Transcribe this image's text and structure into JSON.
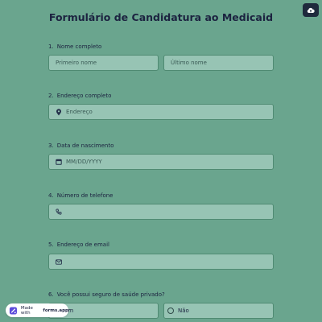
{
  "form": {
    "title": "Formulário de Candidatura ao Medicaid"
  },
  "questions": [
    {
      "number": "1.",
      "label": "Nome completo",
      "fields": [
        "Primeiro nome",
        "Último nome"
      ]
    },
    {
      "number": "2.",
      "label": "Endereço completo",
      "placeholder": "Endereço",
      "icon": "location-pin-icon"
    },
    {
      "number": "3.",
      "label": "Data de nascimento",
      "placeholder": "MM/DD/YYYY",
      "icon": "calendar-icon"
    },
    {
      "number": "4.",
      "label": "Número de telefone",
      "placeholder": "",
      "icon": "phone-icon"
    },
    {
      "number": "5.",
      "label": "Endereço de email",
      "placeholder": "",
      "icon": "mail-icon"
    },
    {
      "number": "6.",
      "label": "Você possui seguro de saúde privado?",
      "options": [
        "Sim",
        "Não"
      ]
    }
  ],
  "badge": {
    "prefix": "Made with",
    "brand": "forms.app"
  },
  "colors": {
    "background": "#6aa58e",
    "field": "#97c4b4",
    "text": "#1c2340"
  }
}
